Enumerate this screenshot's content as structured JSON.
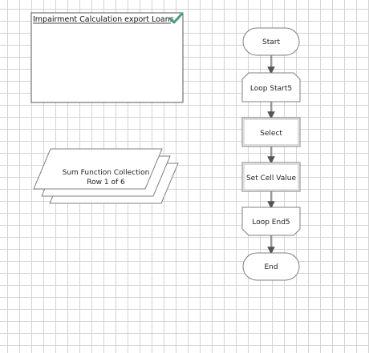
{
  "note": {
    "title": "Impairment Calculation export Loans -"
  },
  "collection": {
    "line1": "Sum Function Collection",
    "line2": "Row 1 of 6"
  },
  "flow": {
    "start": "Start",
    "loop_start": "Loop Start5",
    "select": "Select",
    "set_cell_value": "Set Cell Value",
    "loop_end": "Loop End5",
    "end": "End"
  },
  "colors": {
    "check": "#4a9e7a",
    "stroke": "#7f7f7f",
    "arrow": "#555555"
  }
}
